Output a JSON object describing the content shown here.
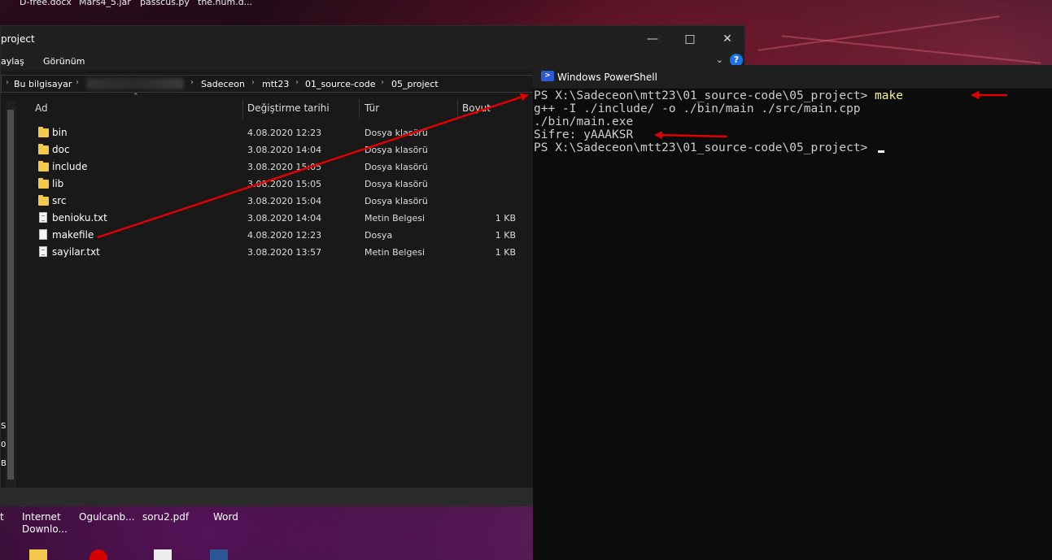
{
  "desktop_top": [
    "D-free.docx",
    "Mars4_5.jar",
    "passcus.py",
    "the.num.d..."
  ],
  "explorer": {
    "title": "project",
    "ribbon_tabs": [
      "aylaş",
      "Görünüm"
    ],
    "breadcrumb": [
      "Bu bilgisayar",
      "Sadeceon",
      "mtt23",
      "01_source-code",
      "05_project"
    ],
    "columns": [
      "Ad",
      "Değiştirme tarihi",
      "Tür",
      "Boyut"
    ],
    "files": [
      {
        "name": "bin",
        "date": "4.08.2020 12:23",
        "type": "Dosya klasörü",
        "size": "",
        "icon": "folder-icon"
      },
      {
        "name": "doc",
        "date": "3.08.2020 14:04",
        "type": "Dosya klasörü",
        "size": "",
        "icon": "folder-icon"
      },
      {
        "name": "include",
        "date": "3.08.2020 15:05",
        "type": "Dosya klasörü",
        "size": "",
        "icon": "folder-icon"
      },
      {
        "name": "lib",
        "date": "3.08.2020 15:05",
        "type": "Dosya klasörü",
        "size": "",
        "icon": "folder-icon"
      },
      {
        "name": "src",
        "date": "3.08.2020 15:04",
        "type": "Dosya klasörü",
        "size": "",
        "icon": "folder-icon"
      },
      {
        "name": "benioku.txt",
        "date": "3.08.2020 14:04",
        "type": "Metin Belgesi",
        "size": "1 KB",
        "icon": "text-file-icon"
      },
      {
        "name": "makefile",
        "date": "4.08.2020 12:23",
        "type": "Dosya",
        "size": "1 KB",
        "icon": "file-icon"
      },
      {
        "name": "sayilar.txt",
        "date": "3.08.2020 13:57",
        "type": "Metin Belgesi",
        "size": "1 KB",
        "icon": "text-file-icon"
      }
    ],
    "nav_chars": [
      "S",
      "0",
      "B"
    ]
  },
  "powershell": {
    "title": "Windows PowerShell",
    "lines": [
      {
        "prompt": "PS X:\\Sadeceon\\mtt23\\01_source-code\\05_project> ",
        "cmd": "make"
      },
      {
        "prompt": "g++ -I ./include/ -o ./bin/main ./src/main.cpp",
        "cmd": ""
      },
      {
        "prompt": "./bin/main.exe",
        "cmd": ""
      },
      {
        "prompt": "Sifre: yAAAKSR",
        "cmd": ""
      },
      {
        "prompt": "PS X:\\Sadeceon\\mtt23\\01_source-code\\05_project> ",
        "cmd": ""
      }
    ]
  },
  "taskbar_labels": [
    "t",
    "Internet\nDownlo...",
    "Ogulcanb...",
    "soru2.pdf",
    "Word"
  ],
  "colors": {
    "arrow": "#e00000",
    "command": "#f9f1a5",
    "terminal_bg": "#0c0c0c"
  }
}
